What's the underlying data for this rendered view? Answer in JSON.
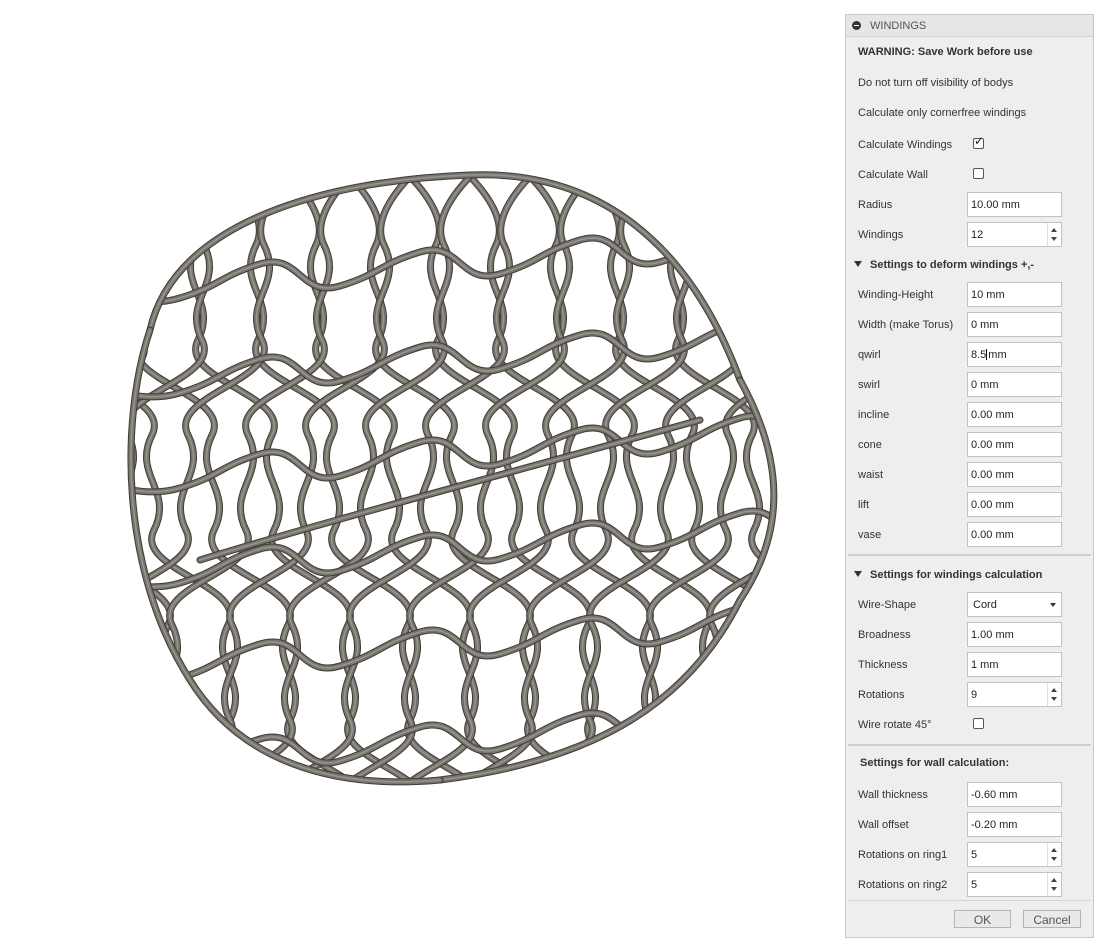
{
  "panel": {
    "title": "WINDINGS",
    "warning": "WARNING: Save Work before use",
    "note1": "Do not turn off visibility of bodys",
    "note2": "Calculate only cornerfree windings",
    "calc_windings": {
      "label": "Calculate Windings",
      "checked": true
    },
    "calc_wall": {
      "label": "Calculate Wall",
      "checked": false
    },
    "radius": {
      "label": "Radius",
      "value": "10.00 mm"
    },
    "windings": {
      "label": "Windings",
      "value": "12"
    },
    "deform_section": "Settings to deform windings +,-",
    "winding_height": {
      "label": "Winding-Height",
      "value": "10 mm"
    },
    "width_torus": {
      "label": "Width (make Torus)",
      "value": "0 mm"
    },
    "qwirl": {
      "label": "qwirl",
      "value_before_cursor": "8.5",
      "value_after_cursor": "mm"
    },
    "swirl": {
      "label": "swirl",
      "value": "0 mm"
    },
    "incline": {
      "label": "incline",
      "value": "0.00 mm"
    },
    "cone": {
      "label": "cone",
      "value": "0.00 mm"
    },
    "waist": {
      "label": "waist",
      "value": "0.00 mm"
    },
    "lift": {
      "label": "lift",
      "value": "0.00 mm"
    },
    "vase": {
      "label": "vase",
      "value": "0.00 mm"
    },
    "calc_section": "Settings for windings calculation",
    "wire_shape": {
      "label": "Wire-Shape",
      "value": "Cord"
    },
    "broadness": {
      "label": "Broadness",
      "value": "1.00 mm"
    },
    "thickness": {
      "label": "Thickness",
      "value": "1 mm"
    },
    "rotations": {
      "label": "Rotations",
      "value": "9"
    },
    "wire_rotate": {
      "label": "Wire rotate 45°",
      "checked": false
    },
    "wall_section": "Settings for wall calculation:",
    "wall_thickness": {
      "label": "Wall thickness",
      "value": "-0.60 mm"
    },
    "wall_offset": {
      "label": "Wall offset",
      "value": "-0.20 mm"
    },
    "rot_ring1": {
      "label": "Rotations on ring1",
      "value": "5"
    },
    "rot_ring2": {
      "label": "Rotations on ring2",
      "value": "5"
    },
    "ok_label": "OK",
    "cancel_label": "Cancel"
  },
  "viewport": {
    "object": "woven wire basket model",
    "colors": {
      "wire": "#77736d",
      "wire_light": "#a8a49c",
      "wire_dark": "#403d38"
    }
  }
}
